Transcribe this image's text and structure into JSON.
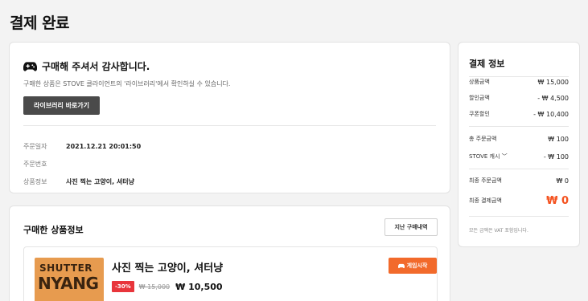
{
  "page": {
    "title": "결제 완료"
  },
  "complete": {
    "title": "구매해 주셔서 감사합니다.",
    "description": "구매한 상품은 STOVE 클라이언트의 '라이브러리'에서 확인하실 수 있습니다.",
    "library_button": "라이브러리 바로가기",
    "info": [
      {
        "label": "주문일자",
        "value": "2021.12.21 20:01:50"
      },
      {
        "label": "주문번호",
        "value": ""
      },
      {
        "label": "상품정보",
        "value": "사진 찍는 고양이, 셔터냥"
      }
    ]
  },
  "products": {
    "title": "구매한 상품정보",
    "history_button": "지난 구매내역",
    "item": {
      "cover_line1": "SHUTTER",
      "cover_line2": "NYANG",
      "name": "사진 찍는 고양이, 셔터냥",
      "discount": "-30%",
      "original_price": "₩ 15,000",
      "price": "₩ 10,500",
      "play_button": "게임시작"
    }
  },
  "payment": {
    "title": "결제 정보",
    "product_amount": {
      "label": "상품금액",
      "value": "₩ 15,000"
    },
    "discount_amount": {
      "label": "할인금액",
      "value": "- ₩ 4,500"
    },
    "coupon_discount": {
      "label": "쿠폰할인",
      "value": "- ₩ 10,400"
    },
    "total_order": {
      "label": "총 주문금액",
      "value": "₩ 100"
    },
    "stove_cash": {
      "label": "STOVE 캐시 ﹀",
      "value": "- ₩ 100"
    },
    "final_order": {
      "label": "최종 주문금액",
      "value": "₩ 0"
    },
    "final_payment": {
      "label": "최종 결제금액",
      "value": "₩ 0"
    },
    "note": "모든 금액은 VAT 포함입니다."
  },
  "colors": {
    "accent": "#f26a2b",
    "discount": "#e8353b",
    "total": "#f4511e"
  },
  "icons": {
    "thanks": "gamepad-icon",
    "play": "gamepad-icon"
  }
}
